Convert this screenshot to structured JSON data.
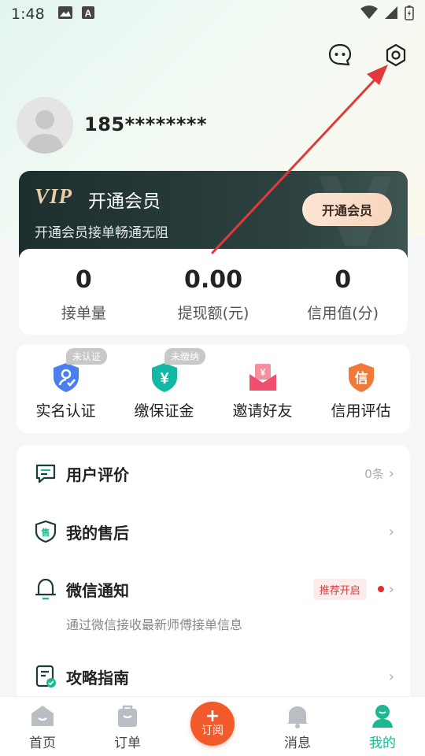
{
  "status_bar": {
    "time": "1:48"
  },
  "profile": {
    "phone_masked": "185********"
  },
  "vip": {
    "logo": "VIP",
    "title": "开通会员",
    "subtitle": "开通会员接单畅通无阻",
    "button_label": "开通会员"
  },
  "stats": [
    {
      "value": "0",
      "label": "接单量"
    },
    {
      "value": "0.00",
      "label": "提现额(元)"
    },
    {
      "value": "0",
      "label": "信用值(分)"
    }
  ],
  "services": [
    {
      "label": "实名认证",
      "badge": "未认证"
    },
    {
      "label": "缴保证金",
      "badge": "未缴纳"
    },
    {
      "label": "邀请好友",
      "badge": ""
    },
    {
      "label": "信用评估",
      "badge": ""
    }
  ],
  "menu": {
    "reviews": {
      "label": "用户评价",
      "count": "0条"
    },
    "after_sales": {
      "label": "我的售后"
    },
    "wechat": {
      "label": "微信通知",
      "tag": "推荐开启",
      "desc": "通过微信接收最新师傅接单信息"
    },
    "guide": {
      "label": "攻略指南"
    }
  },
  "nav": {
    "home": "首页",
    "orders": "订单",
    "subscribe": "订阅",
    "messages": "消息",
    "mine": "我的"
  },
  "colors": {
    "accent_green": "#1bb991",
    "subscribe_orange": "#f25a2c",
    "vip_dark": "#1d2e2e",
    "annotation_red": "#e03a3a"
  }
}
